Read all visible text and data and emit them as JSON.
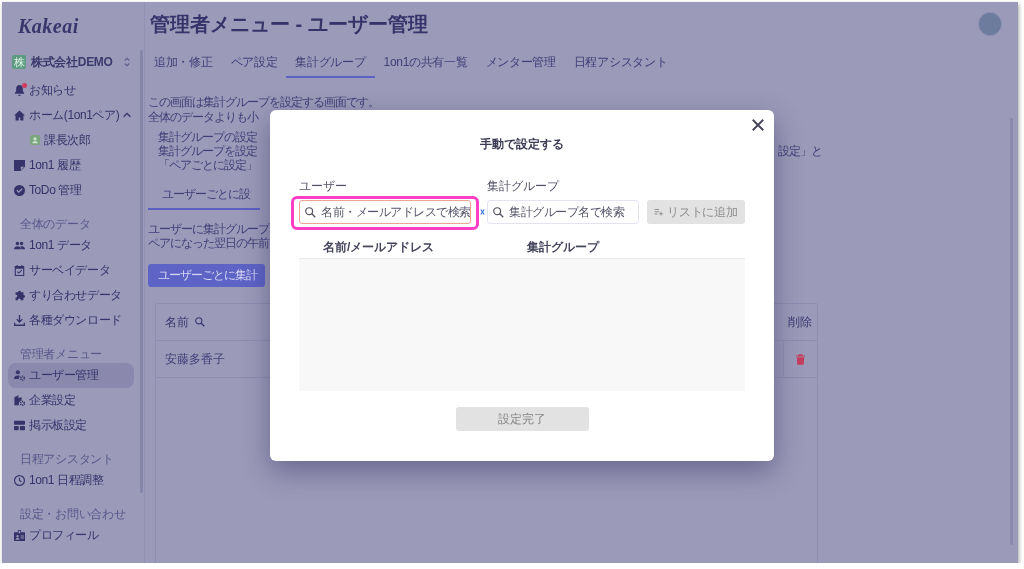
{
  "sidebar": {
    "logo": "Kakeai",
    "company": {
      "badge": "株",
      "name": "株式会社DEMO"
    },
    "groups": [
      {
        "items": [
          {
            "label": "お知らせ",
            "selected": false,
            "unread": true,
            "expanded": false
          },
          {
            "label": "ホーム(1on1ペア)",
            "selected": false,
            "unread": false,
            "expanded": true,
            "children": [
              {
                "label": "課長次郎",
                "selected": false
              }
            ]
          },
          {
            "label": "1on1 履歴",
            "selected": false,
            "unread": false,
            "expanded": false
          },
          {
            "label": "ToDo 管理",
            "selected": false,
            "unread": false,
            "expanded": false
          }
        ]
      },
      {
        "heading": "全体のデータ",
        "items": [
          {
            "label": "1on1 データ",
            "selected": false,
            "unread": false,
            "expanded": false
          },
          {
            "label": "サーベイデータ",
            "selected": false,
            "unread": false,
            "expanded": false
          },
          {
            "label": "すり合わせデータ",
            "selected": false,
            "unread": false,
            "expanded": false
          },
          {
            "label": "各種ダウンロード",
            "selected": false,
            "unread": false,
            "expanded": false
          }
        ]
      },
      {
        "heading": "管理者メニュー",
        "items": [
          {
            "label": "ユーザー管理",
            "selected": true,
            "unread": false,
            "expanded": false
          },
          {
            "label": "企業設定",
            "selected": false,
            "unread": false,
            "expanded": false
          },
          {
            "label": "掲示板設定",
            "selected": false,
            "unread": false,
            "expanded": false
          }
        ]
      },
      {
        "heading": "日程アシスタント",
        "items": [
          {
            "label": "1on1 日程調整",
            "selected": false,
            "unread": false,
            "expanded": false
          }
        ]
      },
      {
        "heading": "設定・お問い合わせ",
        "items": [
          {
            "label": "プロフィール",
            "selected": false,
            "unread": false,
            "expanded": false
          }
        ]
      }
    ]
  },
  "header": {
    "title": "管理者メニュー - ユーザー管理"
  },
  "tabs": [
    {
      "label": "追加・修正",
      "selected": false
    },
    {
      "label": "ペア設定",
      "selected": false
    },
    {
      "label": "集計グループ",
      "selected": true
    },
    {
      "label": "1on1の共有一覧",
      "selected": false
    },
    {
      "label": "メンター管理",
      "selected": false
    },
    {
      "label": "日程アシスタント",
      "selected": false
    }
  ],
  "content": {
    "intro": [
      "この画面は集計グループを設定する画面です。",
      "全体のデータよりも小"
    ],
    "notes": [
      {
        "text": "集計グループの設定"
      },
      {
        "text": "集計グループを設定",
        "right_fragment": "設定」と"
      },
      {
        "text": "「ペアごとに設定」"
      }
    ],
    "subtabs": [
      {
        "label": "ユーザーごとに設",
        "selected": true
      }
    ],
    "description": [
      "ユーザーに集計グループ",
      "ペアになった翌日の午前"
    ],
    "button": "ユーザーごとに集計"
  },
  "table": {
    "columns": [
      {
        "label": "名前",
        "searchable": true
      },
      {
        "label": "削除",
        "searchable": false
      }
    ],
    "rows": [
      {
        "name": "安藤多香子"
      }
    ]
  },
  "modal": {
    "title": "手動で設定する",
    "fields": [
      {
        "label": "ユーザー",
        "placeholder": "名前・メールアドレスで検索",
        "focused": true,
        "highlighted": true
      },
      {
        "label": "集計グループ",
        "placeholder": "集計グループ名で検索",
        "focused": false,
        "highlighted": false
      }
    ],
    "add_button": {
      "label": "リストに追加",
      "disabled": true
    },
    "list": {
      "columns": [
        "名前/メールアドレス",
        "集計グループ"
      ]
    },
    "submit_button": {
      "label": "設定完了",
      "disabled": true
    }
  }
}
